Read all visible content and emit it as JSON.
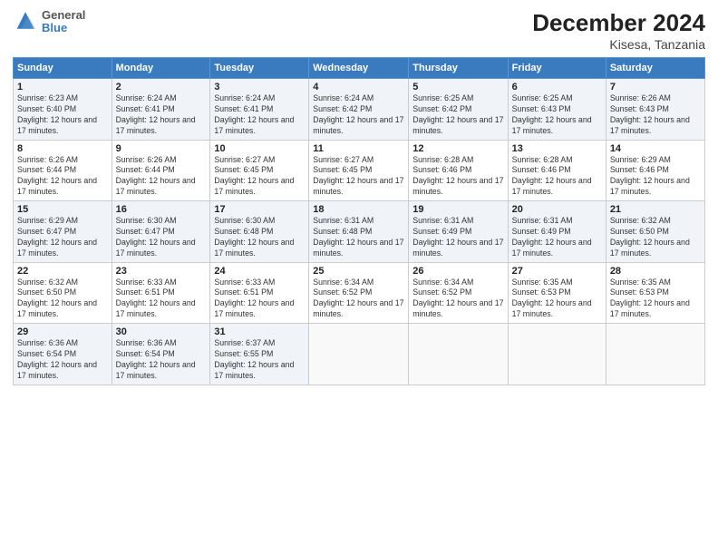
{
  "header": {
    "logo_line1": "General",
    "logo_line2": "Blue",
    "title": "December 2024",
    "subtitle": "Kisesa, Tanzania"
  },
  "days_of_week": [
    "Sunday",
    "Monday",
    "Tuesday",
    "Wednesday",
    "Thursday",
    "Friday",
    "Saturday"
  ],
  "weeks": [
    [
      {
        "day": "1",
        "sunrise": "6:23 AM",
        "sunset": "6:40 PM",
        "daylight": "12 hours and 17 minutes."
      },
      {
        "day": "2",
        "sunrise": "6:24 AM",
        "sunset": "6:41 PM",
        "daylight": "12 hours and 17 minutes."
      },
      {
        "day": "3",
        "sunrise": "6:24 AM",
        "sunset": "6:41 PM",
        "daylight": "12 hours and 17 minutes."
      },
      {
        "day": "4",
        "sunrise": "6:24 AM",
        "sunset": "6:42 PM",
        "daylight": "12 hours and 17 minutes."
      },
      {
        "day": "5",
        "sunrise": "6:25 AM",
        "sunset": "6:42 PM",
        "daylight": "12 hours and 17 minutes."
      },
      {
        "day": "6",
        "sunrise": "6:25 AM",
        "sunset": "6:43 PM",
        "daylight": "12 hours and 17 minutes."
      },
      {
        "day": "7",
        "sunrise": "6:26 AM",
        "sunset": "6:43 PM",
        "daylight": "12 hours and 17 minutes."
      }
    ],
    [
      {
        "day": "8",
        "sunrise": "6:26 AM",
        "sunset": "6:44 PM",
        "daylight": "12 hours and 17 minutes."
      },
      {
        "day": "9",
        "sunrise": "6:26 AM",
        "sunset": "6:44 PM",
        "daylight": "12 hours and 17 minutes."
      },
      {
        "day": "10",
        "sunrise": "6:27 AM",
        "sunset": "6:45 PM",
        "daylight": "12 hours and 17 minutes."
      },
      {
        "day": "11",
        "sunrise": "6:27 AM",
        "sunset": "6:45 PM",
        "daylight": "12 hours and 17 minutes."
      },
      {
        "day": "12",
        "sunrise": "6:28 AM",
        "sunset": "6:46 PM",
        "daylight": "12 hours and 17 minutes."
      },
      {
        "day": "13",
        "sunrise": "6:28 AM",
        "sunset": "6:46 PM",
        "daylight": "12 hours and 17 minutes."
      },
      {
        "day": "14",
        "sunrise": "6:29 AM",
        "sunset": "6:46 PM",
        "daylight": "12 hours and 17 minutes."
      }
    ],
    [
      {
        "day": "15",
        "sunrise": "6:29 AM",
        "sunset": "6:47 PM",
        "daylight": "12 hours and 17 minutes."
      },
      {
        "day": "16",
        "sunrise": "6:30 AM",
        "sunset": "6:47 PM",
        "daylight": "12 hours and 17 minutes."
      },
      {
        "day": "17",
        "sunrise": "6:30 AM",
        "sunset": "6:48 PM",
        "daylight": "12 hours and 17 minutes."
      },
      {
        "day": "18",
        "sunrise": "6:31 AM",
        "sunset": "6:48 PM",
        "daylight": "12 hours and 17 minutes."
      },
      {
        "day": "19",
        "sunrise": "6:31 AM",
        "sunset": "6:49 PM",
        "daylight": "12 hours and 17 minutes."
      },
      {
        "day": "20",
        "sunrise": "6:31 AM",
        "sunset": "6:49 PM",
        "daylight": "12 hours and 17 minutes."
      },
      {
        "day": "21",
        "sunrise": "6:32 AM",
        "sunset": "6:50 PM",
        "daylight": "12 hours and 17 minutes."
      }
    ],
    [
      {
        "day": "22",
        "sunrise": "6:32 AM",
        "sunset": "6:50 PM",
        "daylight": "12 hours and 17 minutes."
      },
      {
        "day": "23",
        "sunrise": "6:33 AM",
        "sunset": "6:51 PM",
        "daylight": "12 hours and 17 minutes."
      },
      {
        "day": "24",
        "sunrise": "6:33 AM",
        "sunset": "6:51 PM",
        "daylight": "12 hours and 17 minutes."
      },
      {
        "day": "25",
        "sunrise": "6:34 AM",
        "sunset": "6:52 PM",
        "daylight": "12 hours and 17 minutes."
      },
      {
        "day": "26",
        "sunrise": "6:34 AM",
        "sunset": "6:52 PM",
        "daylight": "12 hours and 17 minutes."
      },
      {
        "day": "27",
        "sunrise": "6:35 AM",
        "sunset": "6:53 PM",
        "daylight": "12 hours and 17 minutes."
      },
      {
        "day": "28",
        "sunrise": "6:35 AM",
        "sunset": "6:53 PM",
        "daylight": "12 hours and 17 minutes."
      }
    ],
    [
      {
        "day": "29",
        "sunrise": "6:36 AM",
        "sunset": "6:54 PM",
        "daylight": "12 hours and 17 minutes."
      },
      {
        "day": "30",
        "sunrise": "6:36 AM",
        "sunset": "6:54 PM",
        "daylight": "12 hours and 17 minutes."
      },
      {
        "day": "31",
        "sunrise": "6:37 AM",
        "sunset": "6:55 PM",
        "daylight": "12 hours and 17 minutes."
      },
      null,
      null,
      null,
      null
    ]
  ]
}
